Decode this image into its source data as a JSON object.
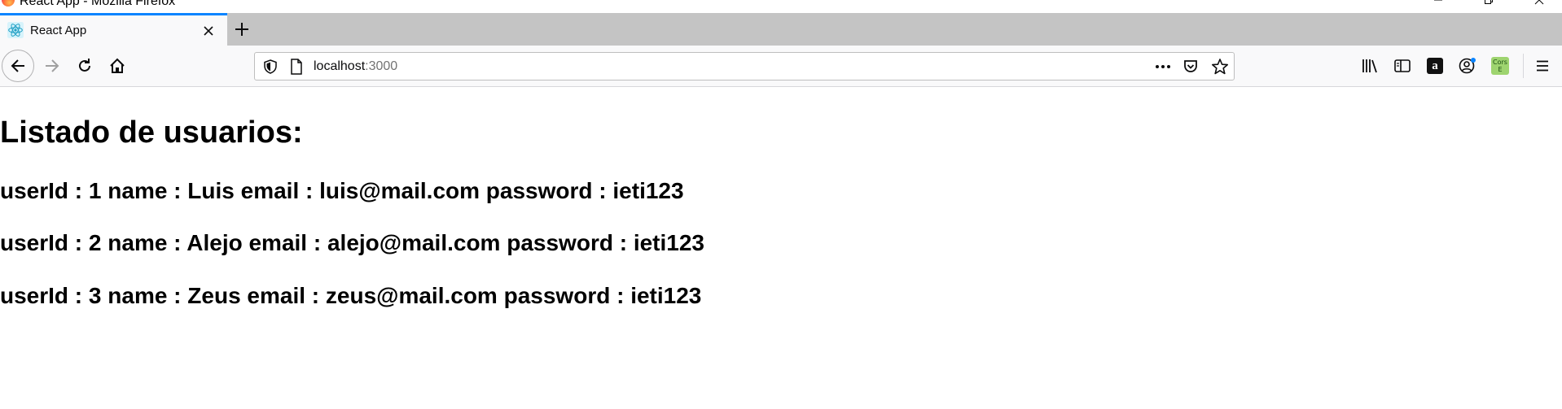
{
  "window": {
    "title": "React App - Mozilla Firefox"
  },
  "tabs": [
    {
      "label": "React App",
      "favicon": "react-icon",
      "active": true
    }
  ],
  "address_bar": {
    "host": "localhost",
    "port": ":3000"
  },
  "toolbar": {
    "extensions": [
      {
        "name": "amazon",
        "text": "a"
      },
      {
        "name": "cors",
        "text_line1": "Cors",
        "text_line2": "E"
      }
    ]
  },
  "colors": {
    "tab_accent": "#0a84ff",
    "tabstrip_bg": "#c4c4c4",
    "navbar_bg": "#f9f9fa",
    "cors_green": "#9ed46f"
  },
  "page": {
    "heading": "Listado de usuarios:",
    "users": [
      {
        "text": "userId : 1 name : Luis email : luis@mail.com password : ieti123"
      },
      {
        "text": "userId : 2 name : Alejo email : alejo@mail.com password : ieti123"
      },
      {
        "text": "userId : 3 name : Zeus email : zeus@mail.com password : ieti123"
      }
    ]
  }
}
